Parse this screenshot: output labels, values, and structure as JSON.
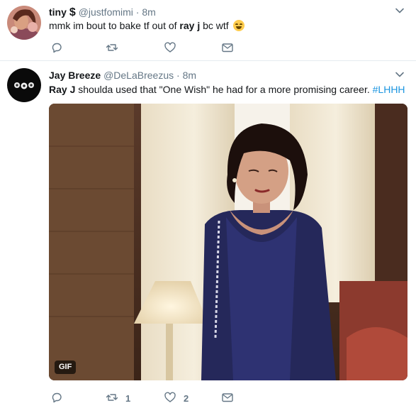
{
  "tweets": [
    {
      "fullname": "tiny",
      "name_emoji": "$",
      "username": "@justfomimi",
      "dot": "·",
      "time": "8m",
      "text_parts": [
        "mmk im bout to bake tf out of ",
        "ray j",
        " bc wtf"
      ],
      "emoji": "face-with-tears-of-joy",
      "actions": {
        "reply": "",
        "retweet": "",
        "like": "",
        "dm": ""
      }
    },
    {
      "fullname": "Jay Breeze",
      "username": "@DeLaBreezus",
      "dot": "·",
      "time": "8m",
      "text_parts": [
        "Ray J",
        " shoulda used that \"One Wish\" he had for a more promising career. ",
        "#LHHH"
      ],
      "media": {
        "type": "gif",
        "badge": "GIF"
      },
      "actions": {
        "reply": "",
        "retweet": "1",
        "like": "2",
        "dm": ""
      }
    }
  ],
  "colors": {
    "text": "#14171a",
    "secondary": "#657786",
    "link": "#1b95e0",
    "divider": "#e6ecf0"
  },
  "icons": [
    "reply-icon",
    "retweet-icon",
    "like-icon",
    "direct-message-icon",
    "caret-down-icon"
  ]
}
